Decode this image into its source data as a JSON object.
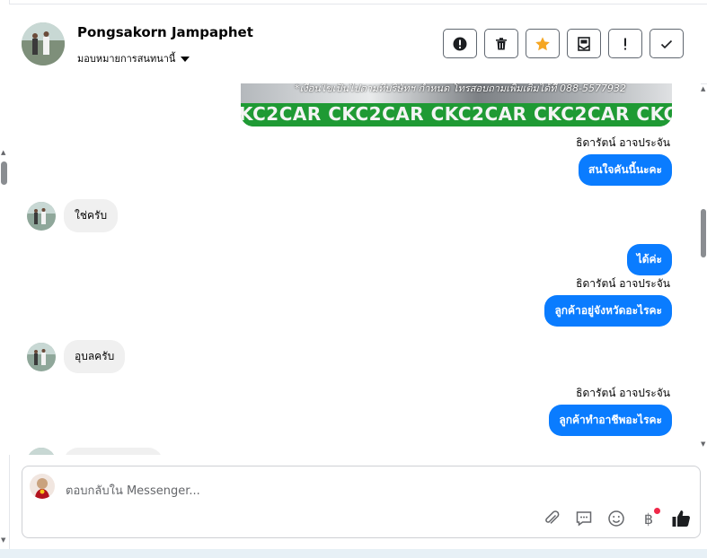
{
  "header": {
    "contact_name": "Pongsakorn Jampaphet",
    "assign_label": "มอบหมายการสนทนานี้",
    "actions": [
      {
        "icon": "alert-circle-icon",
        "label": "Spam"
      },
      {
        "icon": "trash-icon",
        "label": "Delete"
      },
      {
        "icon": "star-icon",
        "label": "Follow up"
      },
      {
        "icon": "mark-unread-icon",
        "label": "Mark as unread"
      },
      {
        "icon": "exclamation-icon",
        "label": "Mark important"
      },
      {
        "icon": "check-icon",
        "label": "Mark done"
      }
    ],
    "star_color": "#f5a623"
  },
  "banner": {
    "caption": "*เงื่อนไขเป็นไปตามที่บริษัทฯ กำหนด โทรสอบถามเพิ่มเติมได้ที่ 088-5577932",
    "repeat_text": "KC2CAR CKC2CAR CKC2CAR CKC2CAR CKC2CAR CKC2"
  },
  "messages": [
    {
      "type": "sender",
      "text": "ธิดารัตน์ อาจประจัน"
    },
    {
      "type": "outgoing",
      "text": "สนใจคันนี้นะคะ"
    },
    {
      "type": "incoming",
      "text": "ใช่ครับ"
    },
    {
      "type": "outgoing",
      "text": "ได้ค่ะ"
    },
    {
      "type": "sender",
      "text": "ธิดารัตน์ อาจประจัน"
    },
    {
      "type": "outgoing",
      "text": "ลูกค้าอยู่จังหวัดอะไรคะ"
    },
    {
      "type": "incoming",
      "text": "อุบลครับ"
    },
    {
      "type": "sender",
      "text": "ธิดารัตน์ อาจประจัน"
    },
    {
      "type": "outgoing",
      "text": "ลูกค้าทำอาชีพอะไรคะ"
    }
  ],
  "composer": {
    "placeholder": "ตอบกลับใน Messenger...",
    "tools": [
      "attachment-icon",
      "saved-reply-icon",
      "emoji-icon",
      "baht-payment-icon",
      "thumbs-up-icon"
    ],
    "baht_symbol": "฿",
    "accent": "#0a7cff",
    "badge_color": "#f02849"
  }
}
